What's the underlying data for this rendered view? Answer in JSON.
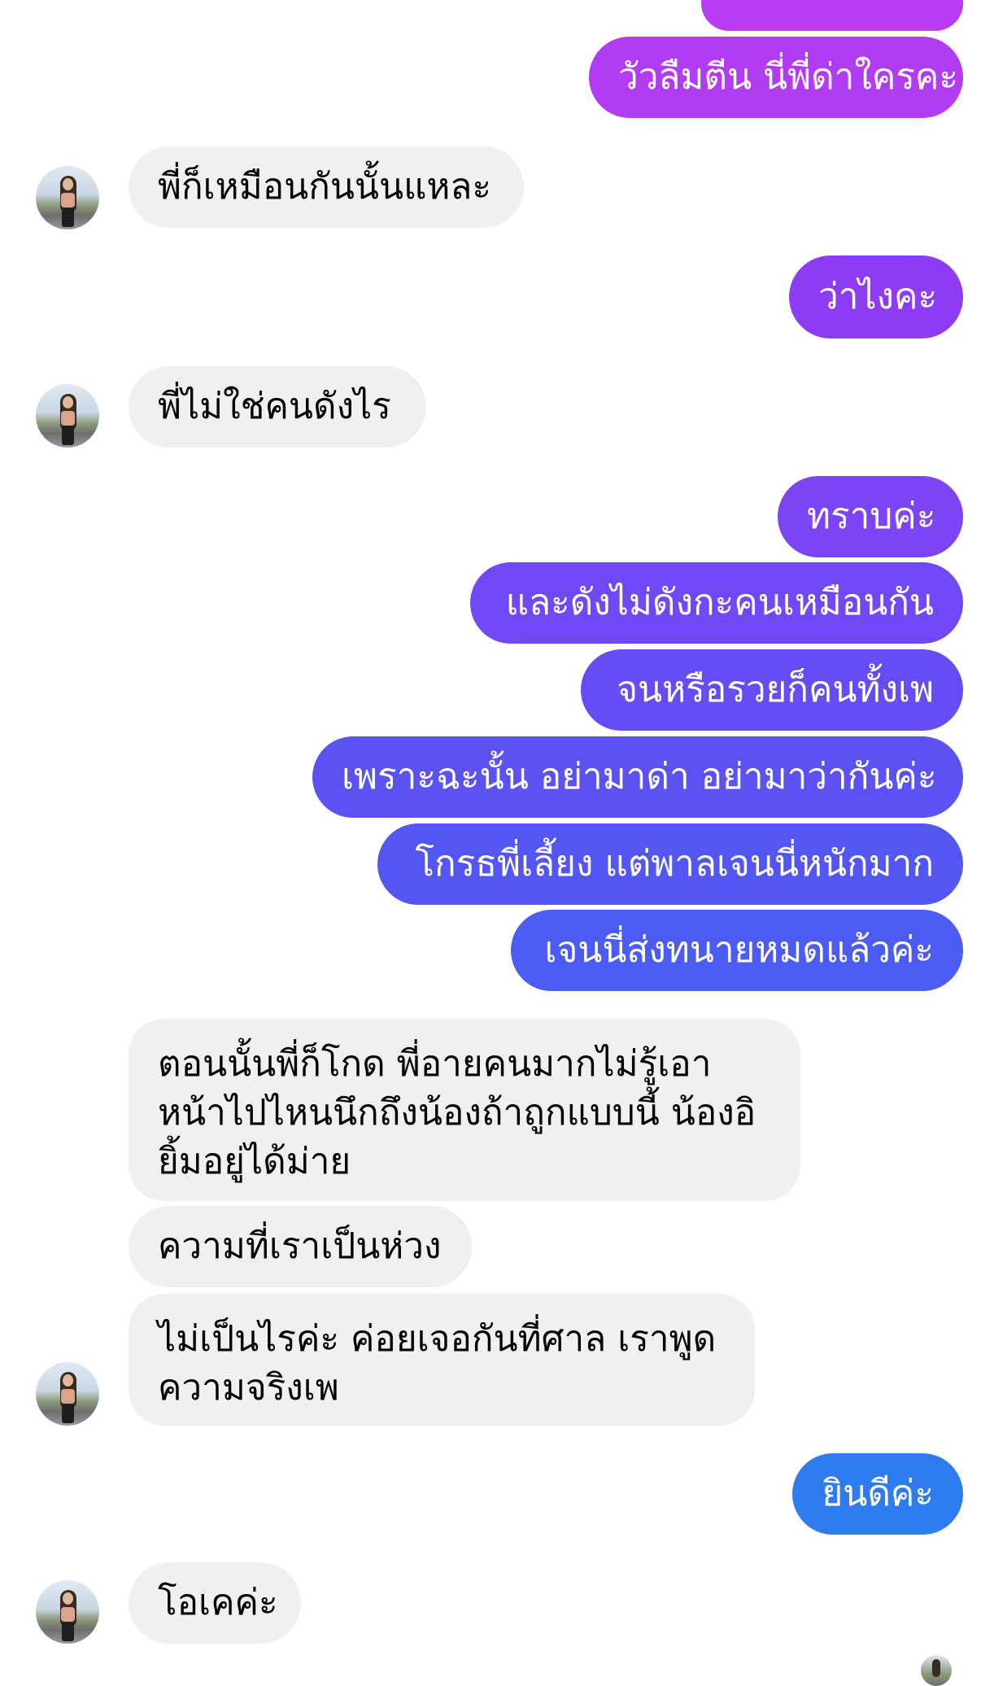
{
  "colors": {
    "incoming_bg": "#f0f0f0",
    "incoming_text": "#050505",
    "outgoing_text": "#ffffff",
    "outgoing_gradient": [
      "#b83cf3",
      "#9a3cf3",
      "#7d44f5",
      "#6a4cf6",
      "#5a55f4",
      "#4e5ef2",
      "#3f6df0",
      "#2f7cf0"
    ]
  },
  "avatar": {
    "icon": "profile-photo-woman"
  },
  "messages": [
    {
      "id": 0,
      "side": "out",
      "text": ""
    },
    {
      "id": 1,
      "side": "out",
      "text": "วัวลืมตีน นี่พี่ด่าใครคะ"
    },
    {
      "id": 2,
      "side": "in",
      "text": "พี่ก็เหมือนกันนั้นแหละ"
    },
    {
      "id": 3,
      "side": "out",
      "text": "ว่าไงคะ"
    },
    {
      "id": 4,
      "side": "in",
      "text": "พี่ไม่ใช่คนดังไร"
    },
    {
      "id": 5,
      "side": "out",
      "text": "ทราบค่ะ"
    },
    {
      "id": 6,
      "side": "out",
      "text": "และดังไม่ดังกะคนเหมือนกัน"
    },
    {
      "id": 7,
      "side": "out",
      "text": "จนหรือรวยก็คนทั้งเพ"
    },
    {
      "id": 8,
      "side": "out",
      "text": "เพราะฉะนั้น อย่ามาด่า อย่ามาว่ากันค่ะ"
    },
    {
      "id": 9,
      "side": "out",
      "text": "โกรธพี่เลี้ยง แต่พาลเจนนี่หนักมาก"
    },
    {
      "id": 10,
      "side": "out",
      "text": "เจนนี่ส่งทนายหมดแล้วค่ะ"
    },
    {
      "id": 11,
      "side": "in",
      "text": "ตอนนั้นพี่ก็โกด พี่อายคนมากไม่รู้เอาหน้าไปไหนนึกถึงน้องถ้าถูกแบบนี้ น้องอิยิ้มอยู่ได้ม่าย"
    },
    {
      "id": 12,
      "side": "in",
      "text": "ความที่เราเป็นห่วง"
    },
    {
      "id": 13,
      "side": "in",
      "text": "ไม่เป็นไรค่ะ ค่อยเจอกันที่ศาล เราพูดความจริงเพ"
    },
    {
      "id": 14,
      "side": "out",
      "text": "ยินดีค่ะ"
    },
    {
      "id": 15,
      "side": "in",
      "text": "โอเคค่ะ"
    }
  ]
}
